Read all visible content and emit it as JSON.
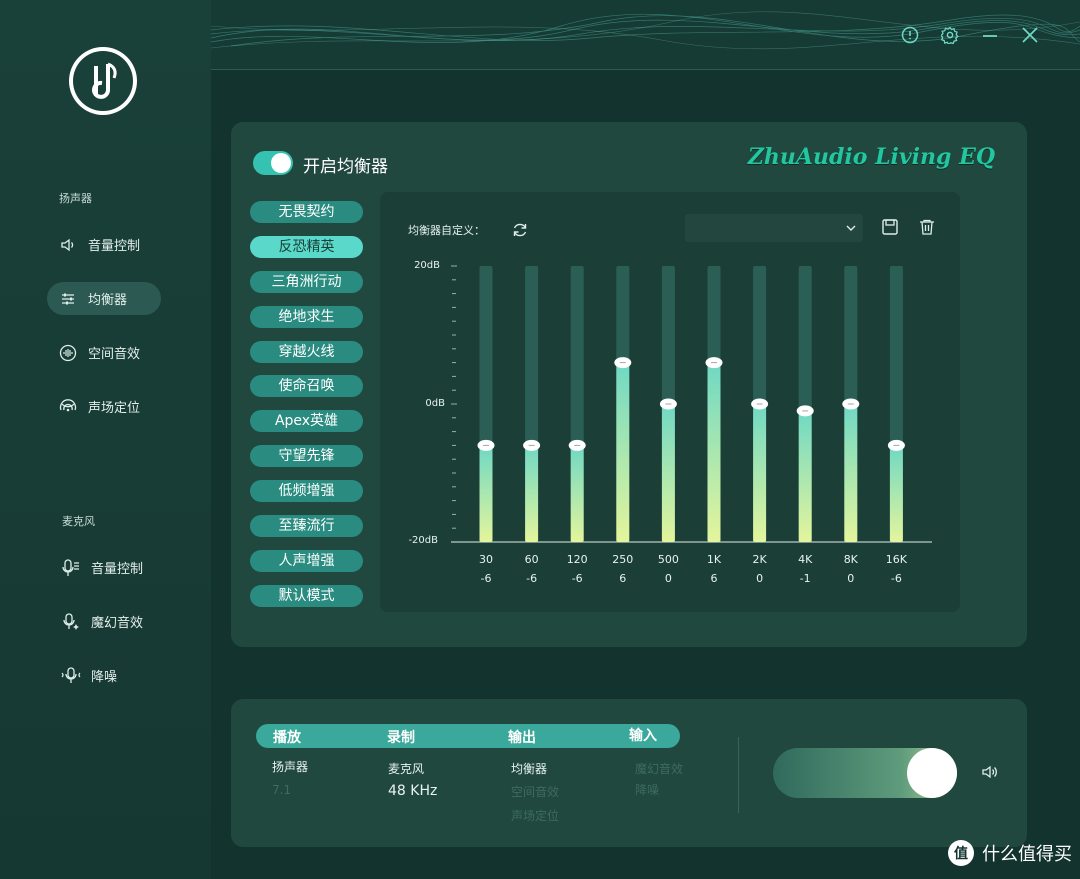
{
  "sidebar": {
    "speaker_section": "扬声器",
    "speaker_items": [
      {
        "label": "音量控制",
        "icon": "speaker-icon"
      },
      {
        "label": "均衡器",
        "icon": "sliders-icon",
        "active": true
      },
      {
        "label": "空间音效",
        "icon": "waveform-icon"
      },
      {
        "label": "声场定位",
        "icon": "radar-icon"
      }
    ],
    "mic_section": "麦克风",
    "mic_items": [
      {
        "label": "音量控制",
        "icon": "mic-icon"
      },
      {
        "label": "魔幻音效",
        "icon": "magic-mic-icon"
      },
      {
        "label": "降噪",
        "icon": "noise-cancel-icon"
      }
    ]
  },
  "topbar": {
    "icons": [
      "info-icon",
      "settings-icon",
      "minimize-icon",
      "close-icon"
    ]
  },
  "eq_panel": {
    "toggle_label": "开启均衡器",
    "toggle_on": true,
    "brand": "ZhuAudio Living EQ",
    "custom_label": "均衡器自定义：",
    "dropdown_value": "",
    "presets": [
      {
        "label": "无畏契约"
      },
      {
        "label": "反恐精英",
        "active": true
      },
      {
        "label": "三角洲行动"
      },
      {
        "label": "绝地求生"
      },
      {
        "label": "穿越火线"
      },
      {
        "label": "使命召唤"
      },
      {
        "label": "Apex英雄"
      },
      {
        "label": "守望先锋"
      },
      {
        "label": "低频增强"
      },
      {
        "label": "至臻流行"
      },
      {
        "label": "人声增强"
      },
      {
        "label": "默认模式"
      }
    ],
    "db_labels": {
      "top": "20dB",
      "mid": "0dB",
      "bottom": "-20dB"
    },
    "colors": {
      "track": "#2b5f55",
      "fill_top": "#6fd8c4",
      "fill_bottom": "#e4f59c",
      "accent": "#36c2b1"
    }
  },
  "chart_data": {
    "type": "bar",
    "categories": [
      "30",
      "60",
      "120",
      "250",
      "500",
      "1K",
      "2K",
      "4K",
      "8K",
      "16K"
    ],
    "values": [
      -6,
      -6,
      -6,
      6,
      0,
      6,
      0,
      -1,
      0,
      -6
    ],
    "value_labels": [
      "-6",
      "-6",
      "-6",
      "6",
      "0",
      "6",
      "0",
      "-1",
      "0",
      "-6"
    ],
    "ylim": [
      -20,
      20
    ],
    "ytick_labels": [
      "20dB",
      "0dB",
      "-20dB"
    ]
  },
  "bottom_panel": {
    "tabs": [
      "播放",
      "录制",
      "输出",
      "输入"
    ],
    "playback": {
      "device": "扬声器",
      "channel": "7.1"
    },
    "record": {
      "device": "麦克风",
      "rate": "48 KHz"
    },
    "output": {
      "active": "均衡器",
      "dim1": "空间音效",
      "dim2": "声场定位"
    },
    "input": {
      "dim1": "魔幻音效",
      "dim2": "降噪"
    },
    "volume_level": 1.0
  },
  "watermark": {
    "text": "什么值得买",
    "badge": "值"
  }
}
